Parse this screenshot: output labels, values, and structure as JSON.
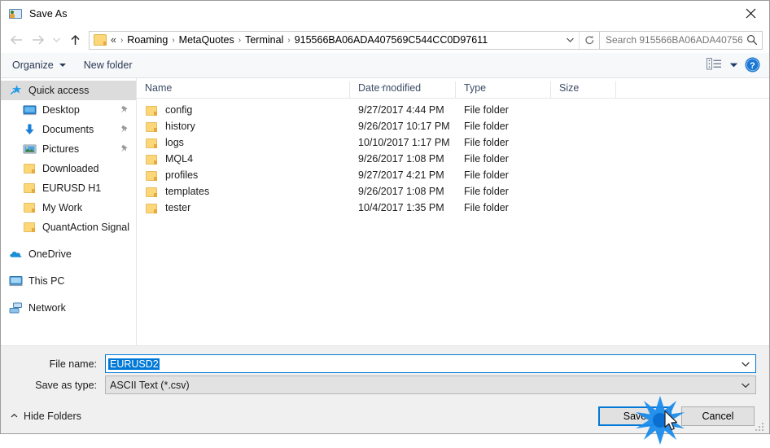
{
  "window": {
    "title": "Save As",
    "title_icon": "save-as-icon",
    "close_icon": "close-icon"
  },
  "nav": {
    "back_icon": "back-arrow-icon",
    "forward_icon": "forward-arrow-icon",
    "recent_icon": "chevron-down-icon",
    "up_icon": "up-arrow-icon",
    "address_folder_icon": "folder-icon",
    "breadcrumb_lead": "«",
    "breadcrumbs": [
      "Roaming",
      "MetaQuotes",
      "Terminal",
      "915566BA06ADA407569C544CC0D97611"
    ],
    "separator": "›",
    "dropdown_icon": "chevron-down-icon",
    "refresh_icon": "refresh-icon",
    "search_placeholder": "Search 915566BA06ADA40756...",
    "search_icon": "search-icon"
  },
  "toolbar": {
    "organize_label": "Organize",
    "new_folder_label": "New folder",
    "view_icon": "view-list-icon",
    "view_caret_icon": "chevron-down-icon",
    "help_icon": "help-icon"
  },
  "sidebar": {
    "items": [
      {
        "label": "Quick access",
        "icon": "star-icon",
        "selected": true,
        "indent": false,
        "pinned": false,
        "gap": false
      },
      {
        "label": "Desktop",
        "icon": "desktop-icon",
        "selected": false,
        "indent": true,
        "pinned": true,
        "gap": false
      },
      {
        "label": "Documents",
        "icon": "download-arrow-icon",
        "selected": false,
        "indent": true,
        "pinned": true,
        "gap": false
      },
      {
        "label": "Pictures",
        "icon": "pictures-icon",
        "selected": false,
        "indent": true,
        "pinned": true,
        "gap": false
      },
      {
        "label": "Downloaded",
        "icon": "folder-icon",
        "selected": false,
        "indent": true,
        "pinned": false,
        "gap": false
      },
      {
        "label": "EURUSD H1",
        "icon": "folder-icon",
        "selected": false,
        "indent": true,
        "pinned": false,
        "gap": false
      },
      {
        "label": "My Work",
        "icon": "folder-icon",
        "selected": false,
        "indent": true,
        "pinned": false,
        "gap": false
      },
      {
        "label": "QuantAction Signal",
        "icon": "folder-icon",
        "selected": false,
        "indent": true,
        "pinned": false,
        "gap": false
      },
      {
        "label": "OneDrive",
        "icon": "onedrive-cloud-icon",
        "selected": false,
        "indent": false,
        "pinned": false,
        "gap": true
      },
      {
        "label": "This PC",
        "icon": "computer-icon",
        "selected": false,
        "indent": false,
        "pinned": false,
        "gap": true
      },
      {
        "label": "Network",
        "icon": "network-icon",
        "selected": false,
        "indent": false,
        "pinned": false,
        "gap": true
      }
    ]
  },
  "filelist": {
    "columns": [
      "Name",
      "Date modified",
      "Type",
      "Size"
    ],
    "sort_column": "Name",
    "sort_direction": "ascending",
    "rows": [
      {
        "name": "config",
        "date": "9/27/2017 4:44 PM",
        "type": "File folder",
        "size": ""
      },
      {
        "name": "history",
        "date": "9/26/2017 10:17 PM",
        "type": "File folder",
        "size": ""
      },
      {
        "name": "logs",
        "date": "10/10/2017 1:17 PM",
        "type": "File folder",
        "size": ""
      },
      {
        "name": "MQL4",
        "date": "9/26/2017 1:08 PM",
        "type": "File folder",
        "size": ""
      },
      {
        "name": "profiles",
        "date": "9/27/2017 4:21 PM",
        "type": "File folder",
        "size": ""
      },
      {
        "name": "templates",
        "date": "9/26/2017 1:08 PM",
        "type": "File folder",
        "size": ""
      },
      {
        "name": "tester",
        "date": "10/4/2017 1:35 PM",
        "type": "File folder",
        "size": ""
      }
    ]
  },
  "form": {
    "file_name_label": "File name:",
    "file_name_value": "EURUSD2",
    "save_as_type_label": "Save as type:",
    "save_as_type_value": "ASCII Text (*.csv)",
    "caret_icon": "chevron-down-icon"
  },
  "footer": {
    "hide_folders_label": "Hide Folders",
    "hide_folders_icon": "chevron-up-icon",
    "save_label": "Save",
    "cancel_label": "Cancel",
    "resize_grip_icon": "resize-grip-icon",
    "click_indicator_icon": "click-burst-icon",
    "cursor_icon": "mouse-pointer-icon"
  },
  "colors": {
    "accent": "#0078d7",
    "folder": "#fcd77a",
    "selection": "#dcdcdc",
    "chrome": "#f0f0f0"
  }
}
